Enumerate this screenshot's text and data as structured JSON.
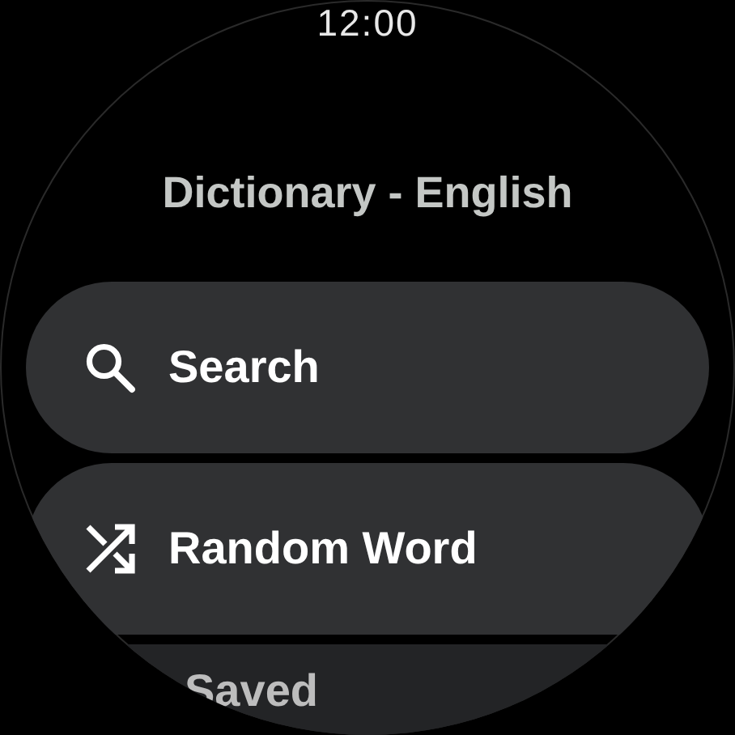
{
  "status_bar": {
    "time": "12:00"
  },
  "title": "Dictionary - English",
  "chips": [
    {
      "label": "Search",
      "kind": "search"
    },
    {
      "label": "Random Word",
      "kind": "shuffle"
    },
    {
      "label": "Saved",
      "kind": "plain"
    }
  ]
}
